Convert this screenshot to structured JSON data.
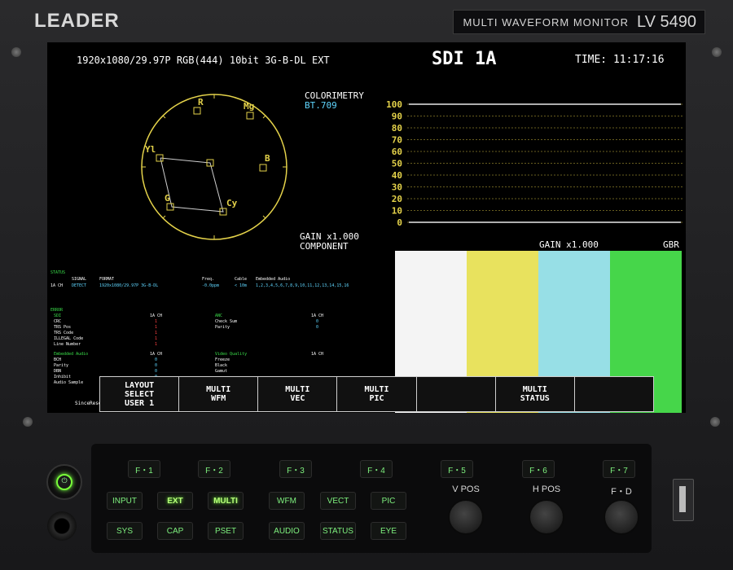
{
  "device": {
    "brand": "LEADER",
    "model_text": "MULTI WAVEFORM MONITOR",
    "model_number": "LV 5490"
  },
  "screen": {
    "signal_format": "1920x1080/29.97P RGB(444) 10bit 3G-B-DL EXT",
    "input_name": "SDI 1A",
    "time_label": "TIME:",
    "time_value": "11:17:16",
    "vector": {
      "targets": {
        "r": "R",
        "mg": "Mg",
        "b": "B",
        "yl": "Yl",
        "g": "G",
        "cy": "Cy"
      },
      "gain": "GAIN x1.000",
      "mode": "COMPONENT"
    },
    "waveform": {
      "colorimetry_label": "COLORIMETRY",
      "colorimetry_value": "BT.709",
      "scale": [
        "100",
        "90",
        "80",
        "70",
        "60",
        "50",
        "40",
        "30",
        "20",
        "10",
        "0"
      ]
    },
    "picture": {
      "gain": "GAIN x1.000",
      "mode": "GBR",
      "bar_colors": [
        "#f4f4f4",
        "#e8e25e",
        "#97dfe6",
        "#46d64a"
      ]
    },
    "status": {
      "title": "STATUS",
      "headers": {
        "signal": "SIGNAL",
        "format": "FORMAT",
        "freq": "Freq.",
        "cable": "Cable",
        "audio": "Embedded Audio"
      },
      "row": {
        "ch": "1A CH",
        "signal": "DETECT",
        "format": "1920x1080/29.97P 3G-B-DL",
        "freq": "-0.0ppm",
        "cable": "< 10m",
        "audio": "1,2,3,4,5,6,7,8,9,10,11,12,13,14,15,16"
      },
      "error_title": "ERROR",
      "sdi_label": "SDI",
      "ch_label": "1A CH",
      "sdi_items": [
        "CRC",
        "TRS Pos",
        "TRS Code",
        "ILLEGAL Code",
        "Line Number"
      ],
      "sdi_values": [
        "1",
        "1",
        "1",
        "1",
        "1"
      ],
      "anc_title": "ANC",
      "anc_items": [
        "Check Sum",
        "Parity"
      ],
      "anc_values": [
        "0",
        "0"
      ],
      "audio_title": "Embedded Audio",
      "audio_items": [
        "BCH",
        "Parity",
        "DBN",
        "Inhibit",
        "Audio Sample"
      ],
      "audio_values": [
        "0",
        "0",
        "0",
        "0",
        "0"
      ],
      "vq_title": "Video Quality",
      "vq_items": [
        "Freeze",
        "Black",
        "Gamut"
      ],
      "since_reset": "SinceReset 00:34:"
    },
    "menu": [
      {
        "lines": [
          "LAYOUT",
          "SELECT",
          "USER 1"
        ]
      },
      {
        "lines": [
          "MULTI",
          "WFM"
        ]
      },
      {
        "lines": [
          "MULTI",
          "VEC"
        ]
      },
      {
        "lines": [
          "MULTI",
          "PIC"
        ]
      },
      {
        "lines": []
      },
      {
        "lines": [
          "MULTI",
          "STATUS"
        ]
      },
      {
        "lines": []
      }
    ]
  },
  "panel": {
    "fkeys": [
      "F・1",
      "F・2",
      "F・3",
      "F・4",
      "F・5",
      "F・6",
      "F・7"
    ],
    "row1": [
      "INPUT",
      "EXT",
      "MULTI",
      "WFM",
      "VECT",
      "PIC"
    ],
    "row2": [
      "SYS",
      "CAP",
      "PSET",
      "AUDIO",
      "STATUS",
      "EYE"
    ],
    "knobs": [
      "V POS",
      "H POS",
      "F・D"
    ]
  }
}
